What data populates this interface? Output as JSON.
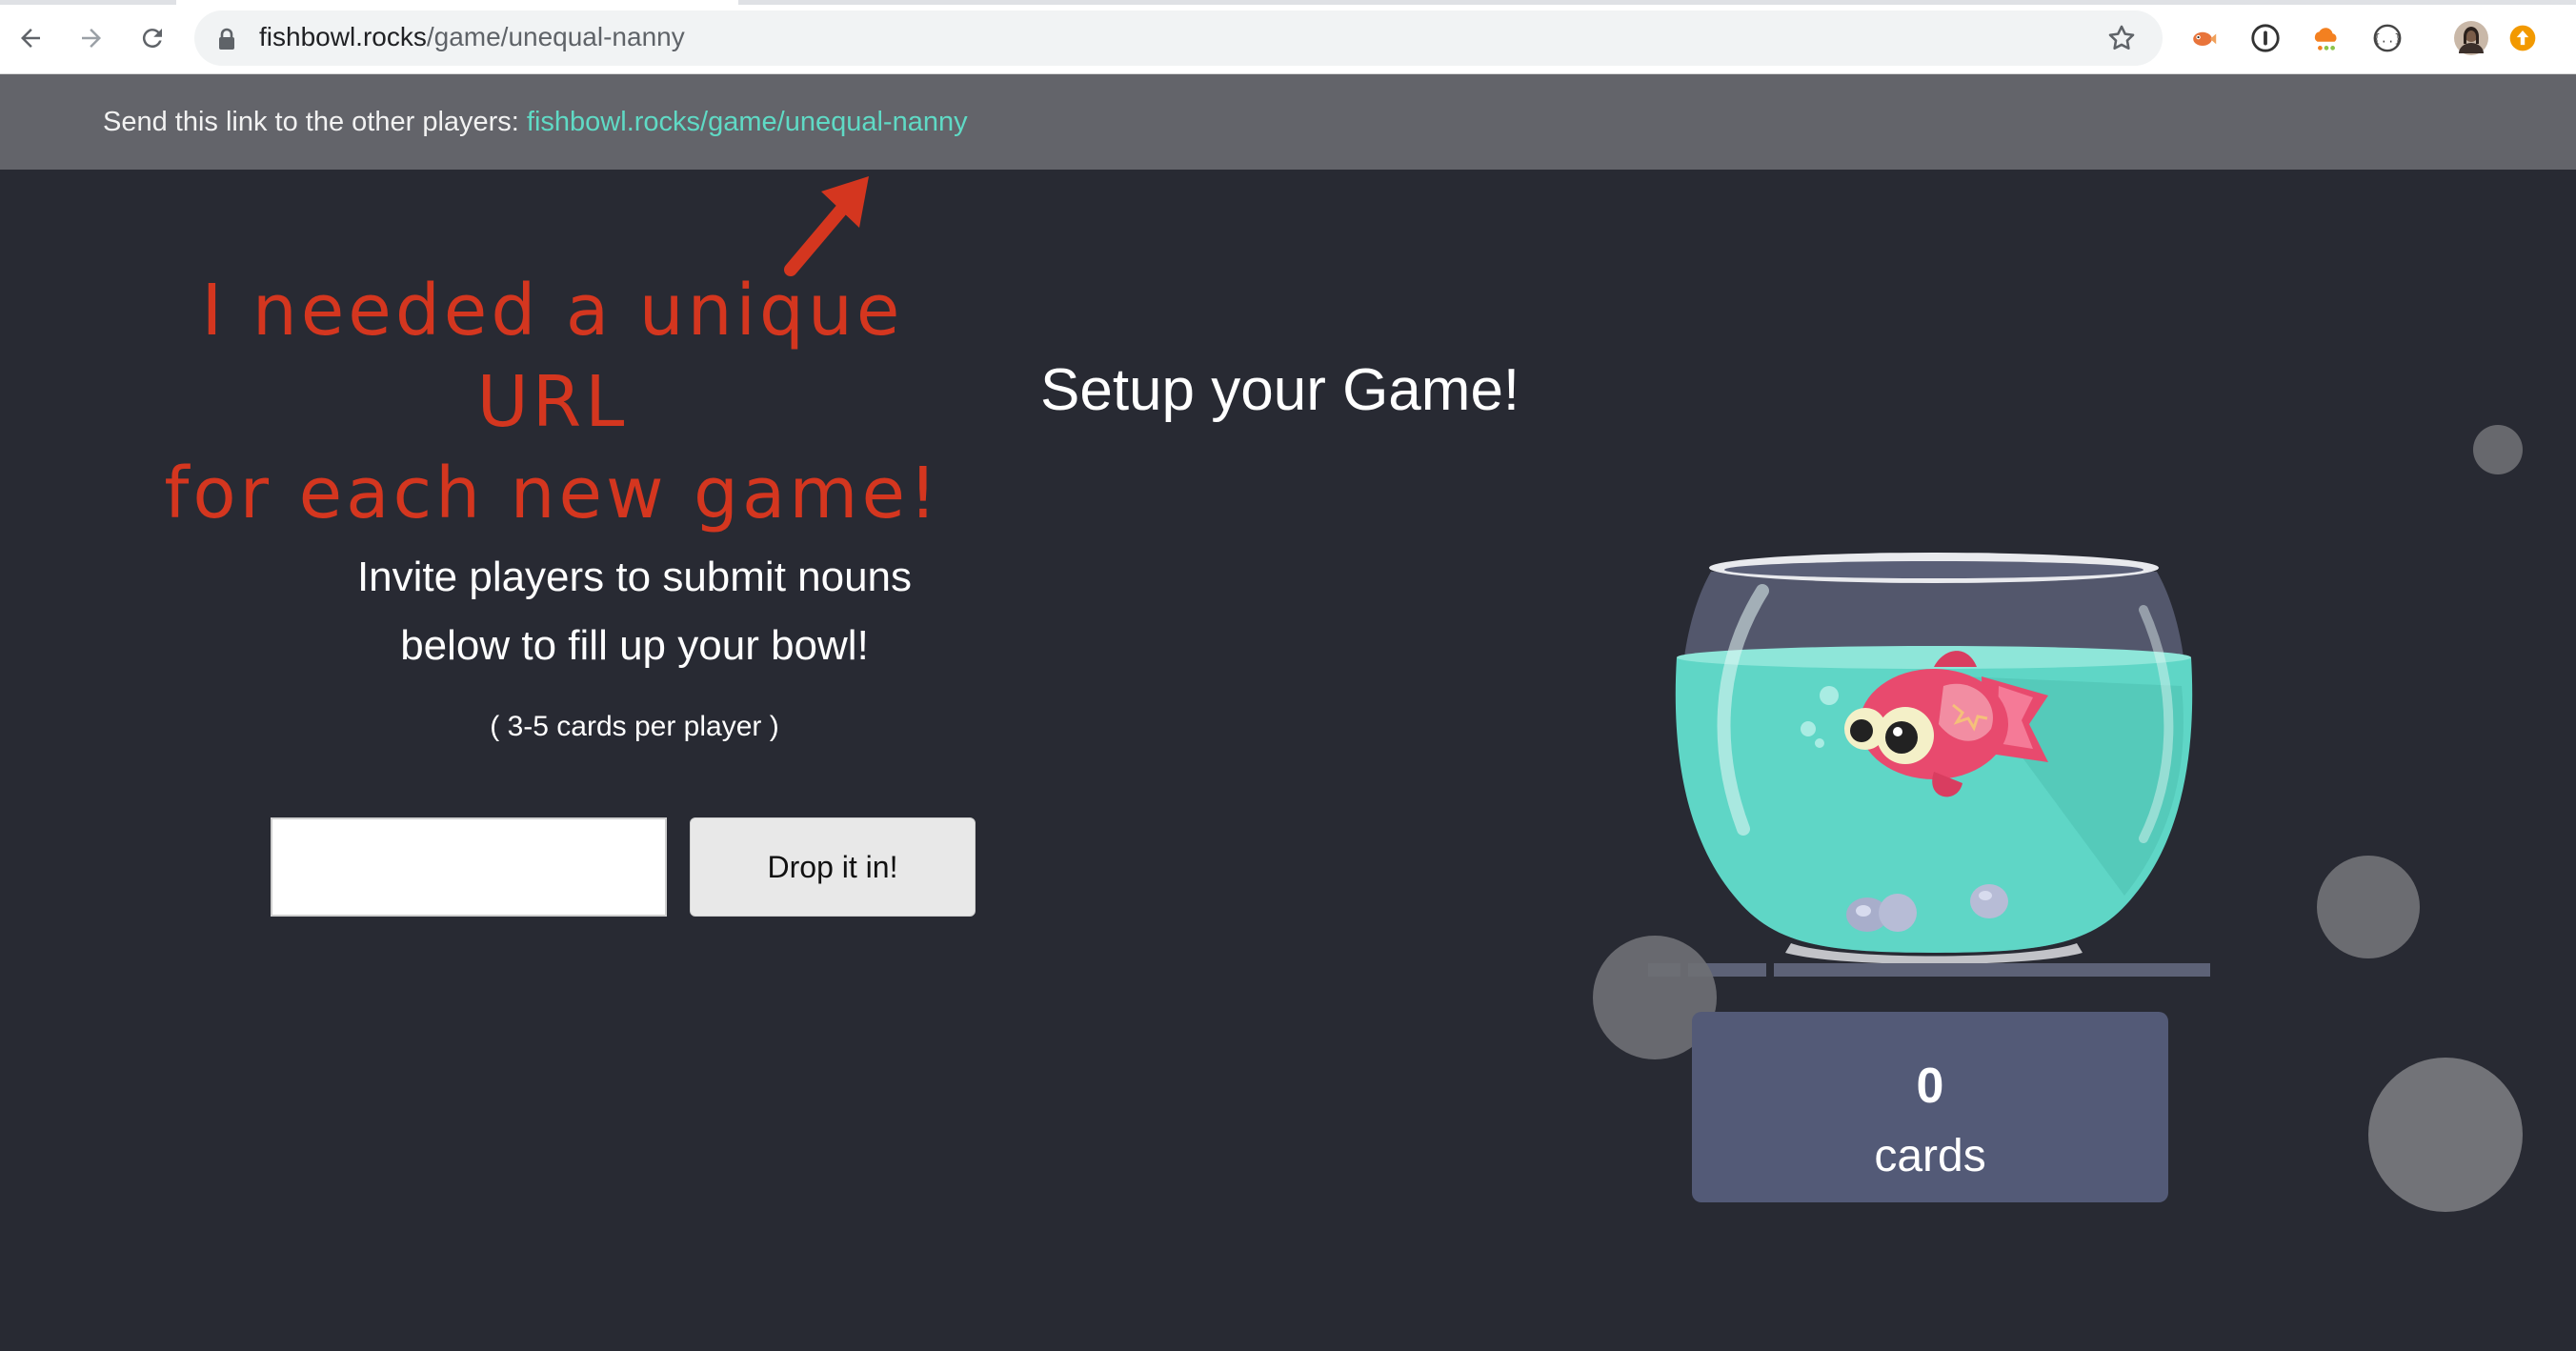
{
  "browser": {
    "url_host": "fishbowl.rocks",
    "url_path": "/game/unequal-nanny",
    "icons": [
      "back-arrow-icon",
      "forward-arrow-icon",
      "reload-icon",
      "lock-icon",
      "star-icon",
      "fish-extension-icon",
      "info-extension-icon",
      "cloud-extension-icon",
      "code-extension-icon",
      "profile-avatar",
      "update-icon"
    ]
  },
  "share": {
    "label": "Send this link to the other players: ",
    "link": "fishbowl.rocks/game/unequal-nanny"
  },
  "annotation": {
    "line1": "I needed a unique URL",
    "line2": "for each new game!",
    "color": "#d4361f"
  },
  "setup": {
    "title": "Setup your Game!",
    "invite_line1": "Invite players to submit nouns",
    "invite_line2": "below to fill up your bowl!",
    "hint": "( 3-5 cards per player )",
    "input_value": "",
    "drop_label": "Drop it in!"
  },
  "bowl": {
    "count": "0",
    "count_label": "cards"
  },
  "colors": {
    "background": "#282a33",
    "banner": "#63646a",
    "link": "#5fdac5",
    "card_box": "#535a77",
    "water": "#5fd6c6"
  }
}
